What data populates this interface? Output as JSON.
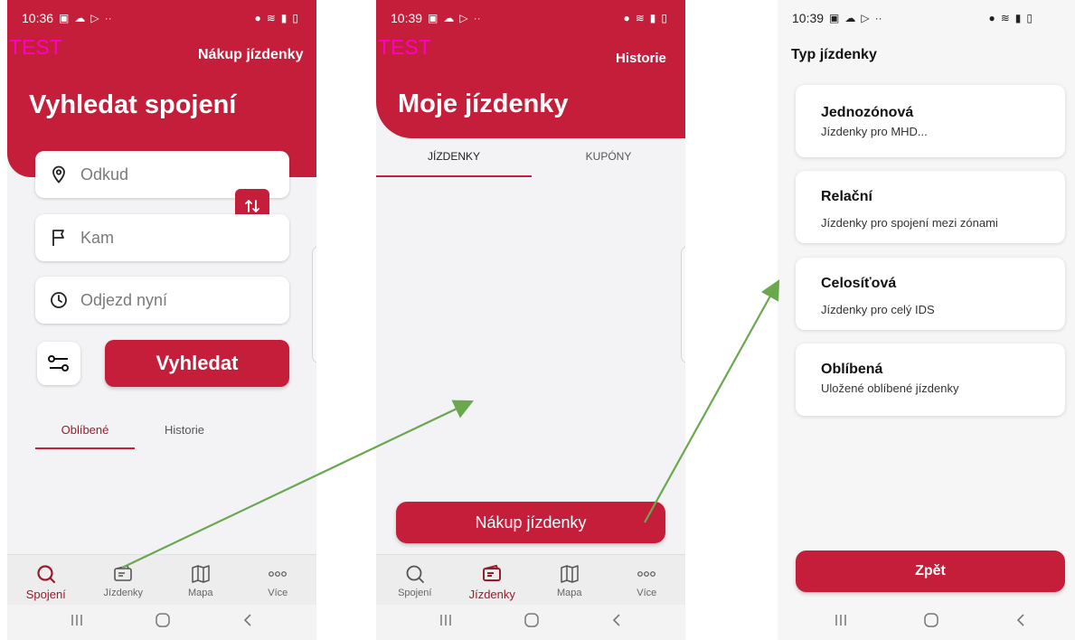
{
  "colors": {
    "brand": "#c41e3a",
    "test_label": "#ff00c8",
    "arrow": "#6aa84f"
  },
  "screen1": {
    "status_time": "10:36",
    "test_label": "TEST",
    "header_action": "Nákup jízdenky",
    "title": "Vyhledat spojení",
    "from_placeholder": "Odkud",
    "to_placeholder": "Kam",
    "depart_placeholder": "Odjezd nyní",
    "search_label": "Vyhledat",
    "tabs": [
      "Oblíbené",
      "Historie"
    ],
    "nav": [
      "Spojení",
      "Jízdenky",
      "Mapa",
      "Více"
    ]
  },
  "screen2": {
    "status_time": "10:39",
    "test_label": "TEST",
    "header_action": "Historie",
    "title": "Moje jízdenky",
    "tabs": [
      "JÍZDENKY",
      "KUPÓNY"
    ],
    "buy_label": "Nákup jízdenky",
    "nav": [
      "Spojení",
      "Jízdenky",
      "Mapa",
      "Více"
    ]
  },
  "screen3": {
    "status_time": "10:39",
    "title": "Typ jízdenky",
    "cards": [
      {
        "title": "Jednozónová",
        "subtitle": "Jízdenky pro MHD..."
      },
      {
        "title": "Relační",
        "subtitle": "Jízdenky pro spojení mezi zónami"
      },
      {
        "title": "Celosíťová",
        "subtitle": "Jízdenky pro celý IDS"
      },
      {
        "title": "Oblíbená",
        "subtitle": "Uložené oblíbené jízdenky"
      }
    ],
    "back_label": "Zpět"
  }
}
